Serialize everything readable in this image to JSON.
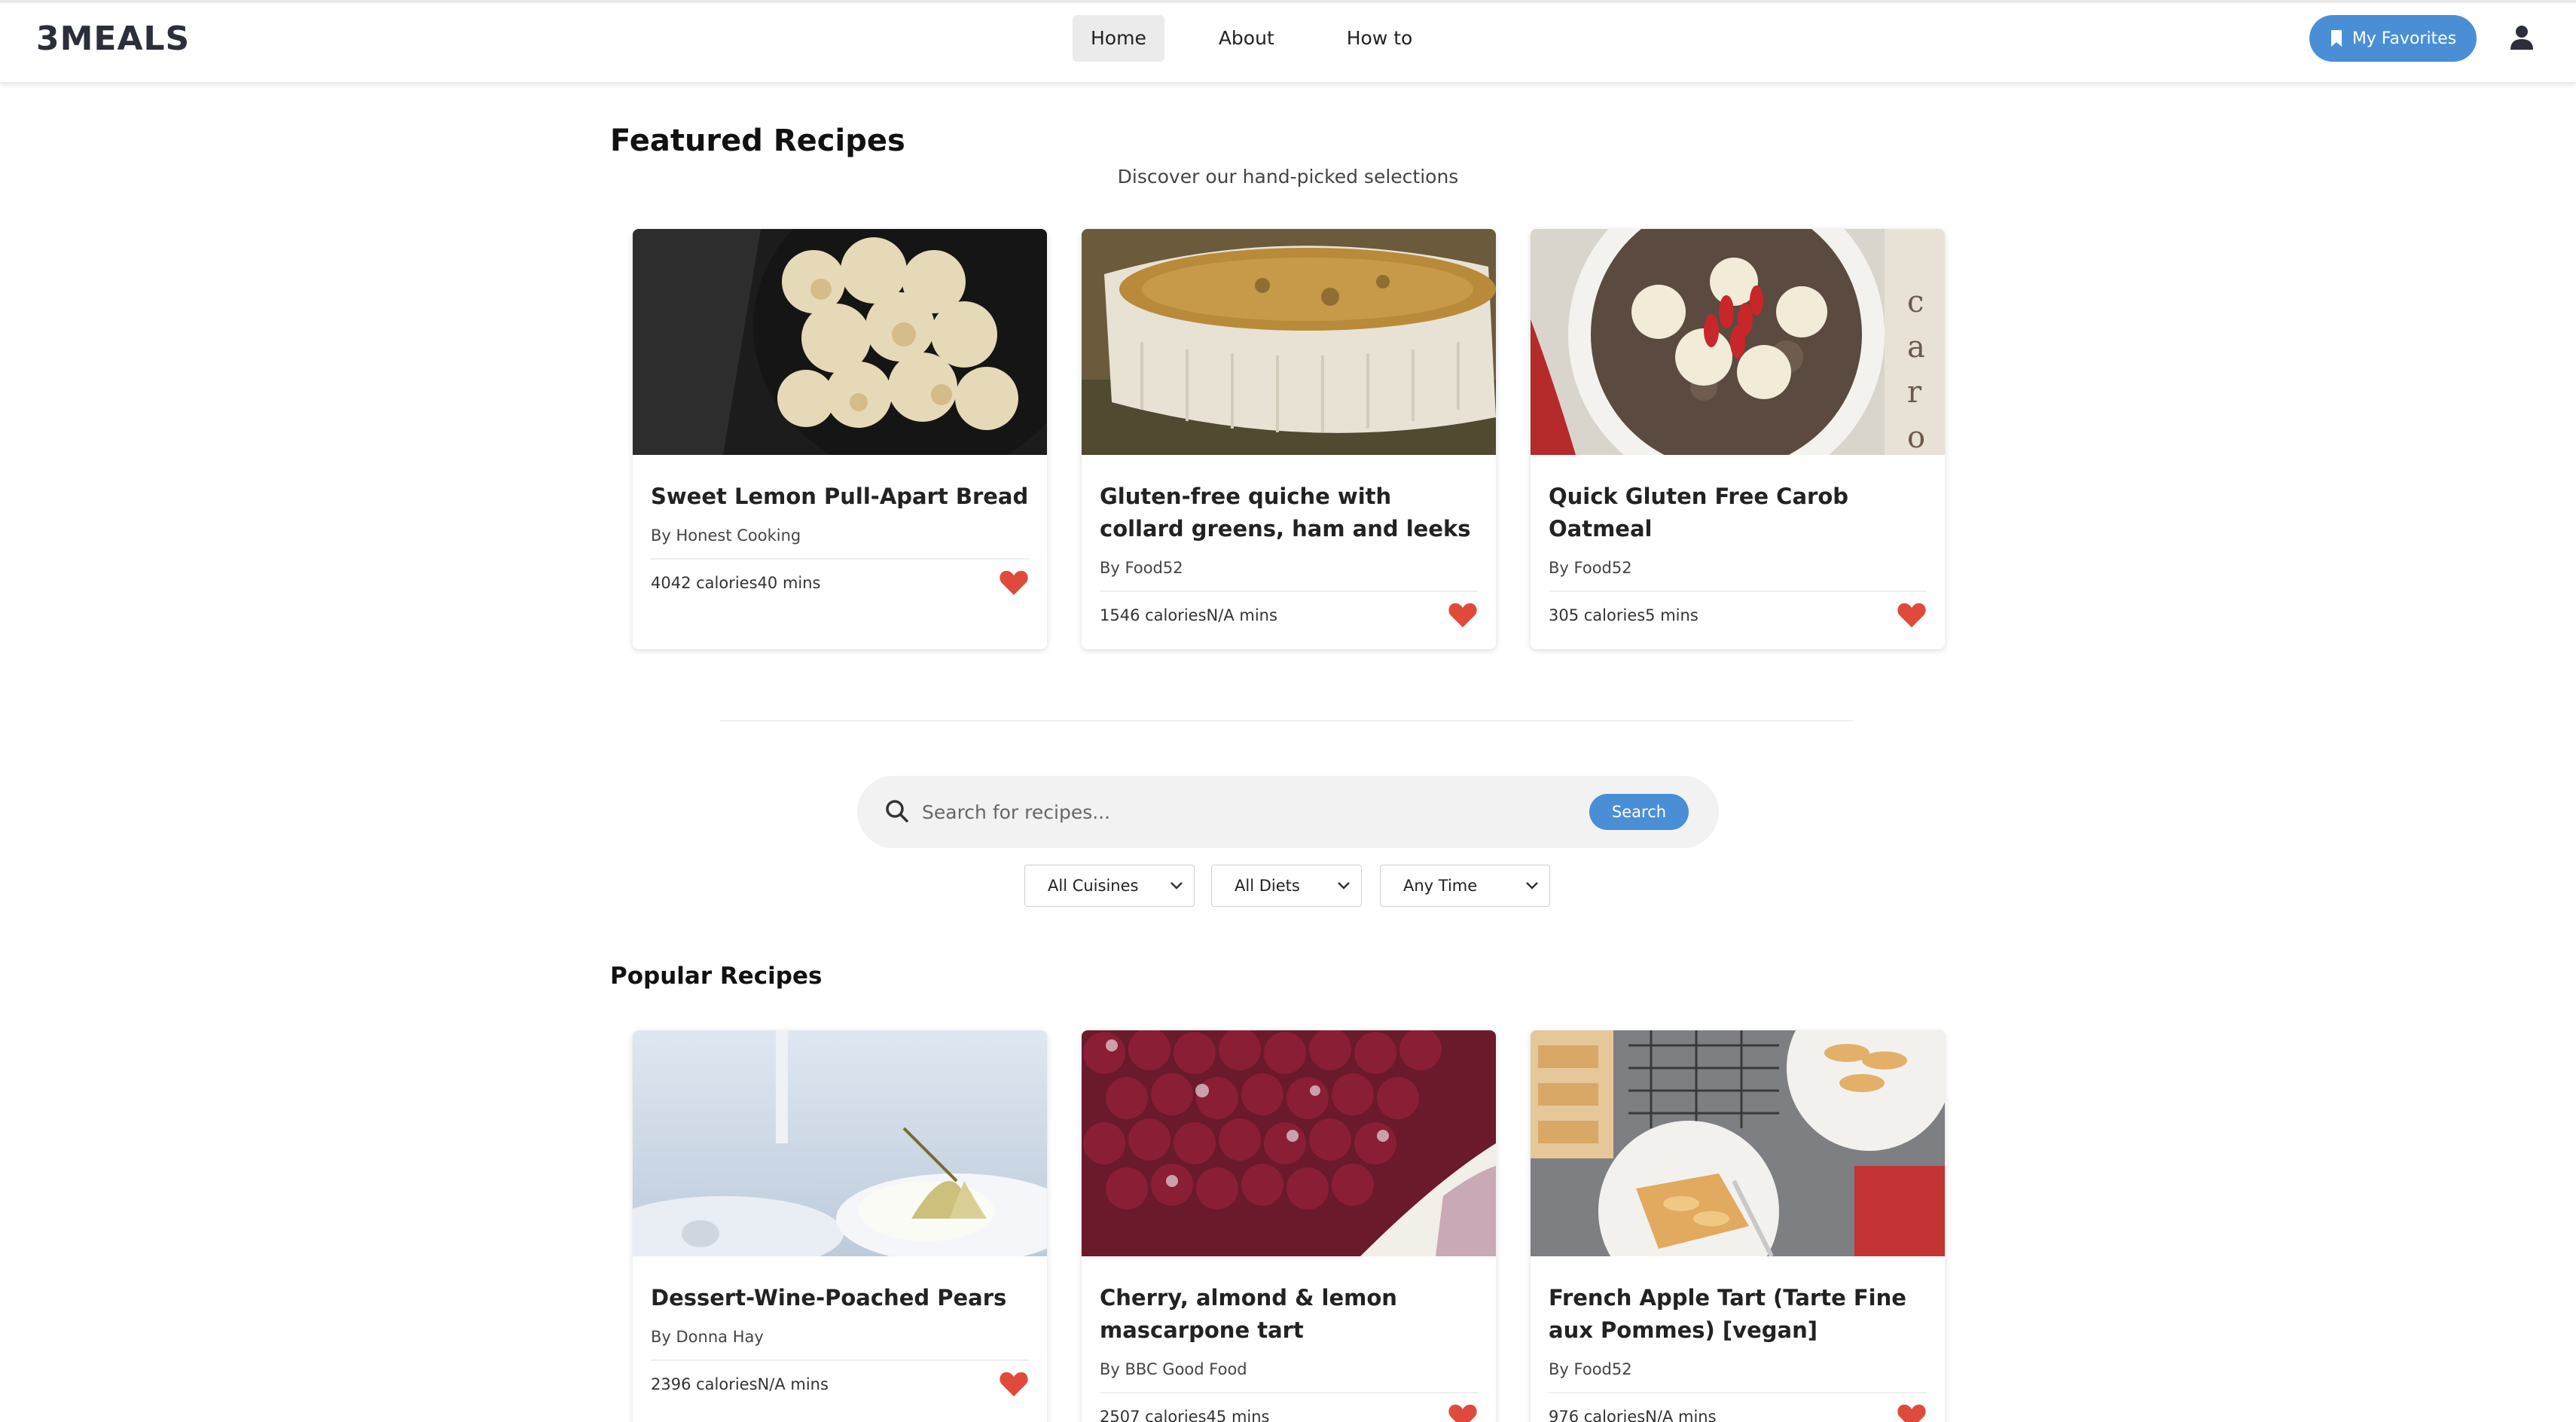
{
  "brand": {
    "logo": "3MEALS"
  },
  "nav": {
    "items": [
      "Home",
      "About",
      "How to"
    ],
    "active": "Home"
  },
  "header": {
    "favorites_label": "My Favorites"
  },
  "featured": {
    "title": "Featured Recipes",
    "subtitle": "Discover our hand-picked selections",
    "cards": [
      {
        "title": "Sweet Lemon Pull-Apart Bread",
        "author": "By Honest Cooking",
        "meta": "4042 calories40 mins"
      },
      {
        "title": "Gluten-free quiche with collard greens, ham and leeks",
        "author": "By Food52",
        "meta": "1546 caloriesN/A mins"
      },
      {
        "title": "Quick Gluten Free Carob Oatmeal",
        "author": "By Food52",
        "meta": "305 calories5 mins"
      }
    ]
  },
  "search": {
    "placeholder": "Search for recipes...",
    "button_label": "Search"
  },
  "filters": {
    "cuisine": "All Cuisines",
    "diet": "All Diets",
    "time": "Any Time"
  },
  "popular": {
    "title": "Popular Recipes",
    "cards": [
      {
        "title": "Dessert-Wine-Poached Pears",
        "author": "By Donna Hay",
        "meta": "2396 caloriesN/A mins"
      },
      {
        "title": "Cherry, almond & lemon mascarpone tart",
        "author": "By BBC Good Food",
        "meta": "2507 calories45 mins"
      },
      {
        "title": "French Apple Tart (Tarte Fine aux Pommes) [vegan]",
        "author": "By Food52",
        "meta": "976 caloriesN/A mins"
      }
    ]
  },
  "colors": {
    "accent": "#4a8fd6",
    "heart": "#e04a3c",
    "logo": "#2a2f3a"
  },
  "icons": {
    "favorites": "bookmark-icon",
    "user": "user-icon",
    "search": "search-icon",
    "heart": "heart-icon",
    "dropdown": "chevron-down-icon"
  }
}
